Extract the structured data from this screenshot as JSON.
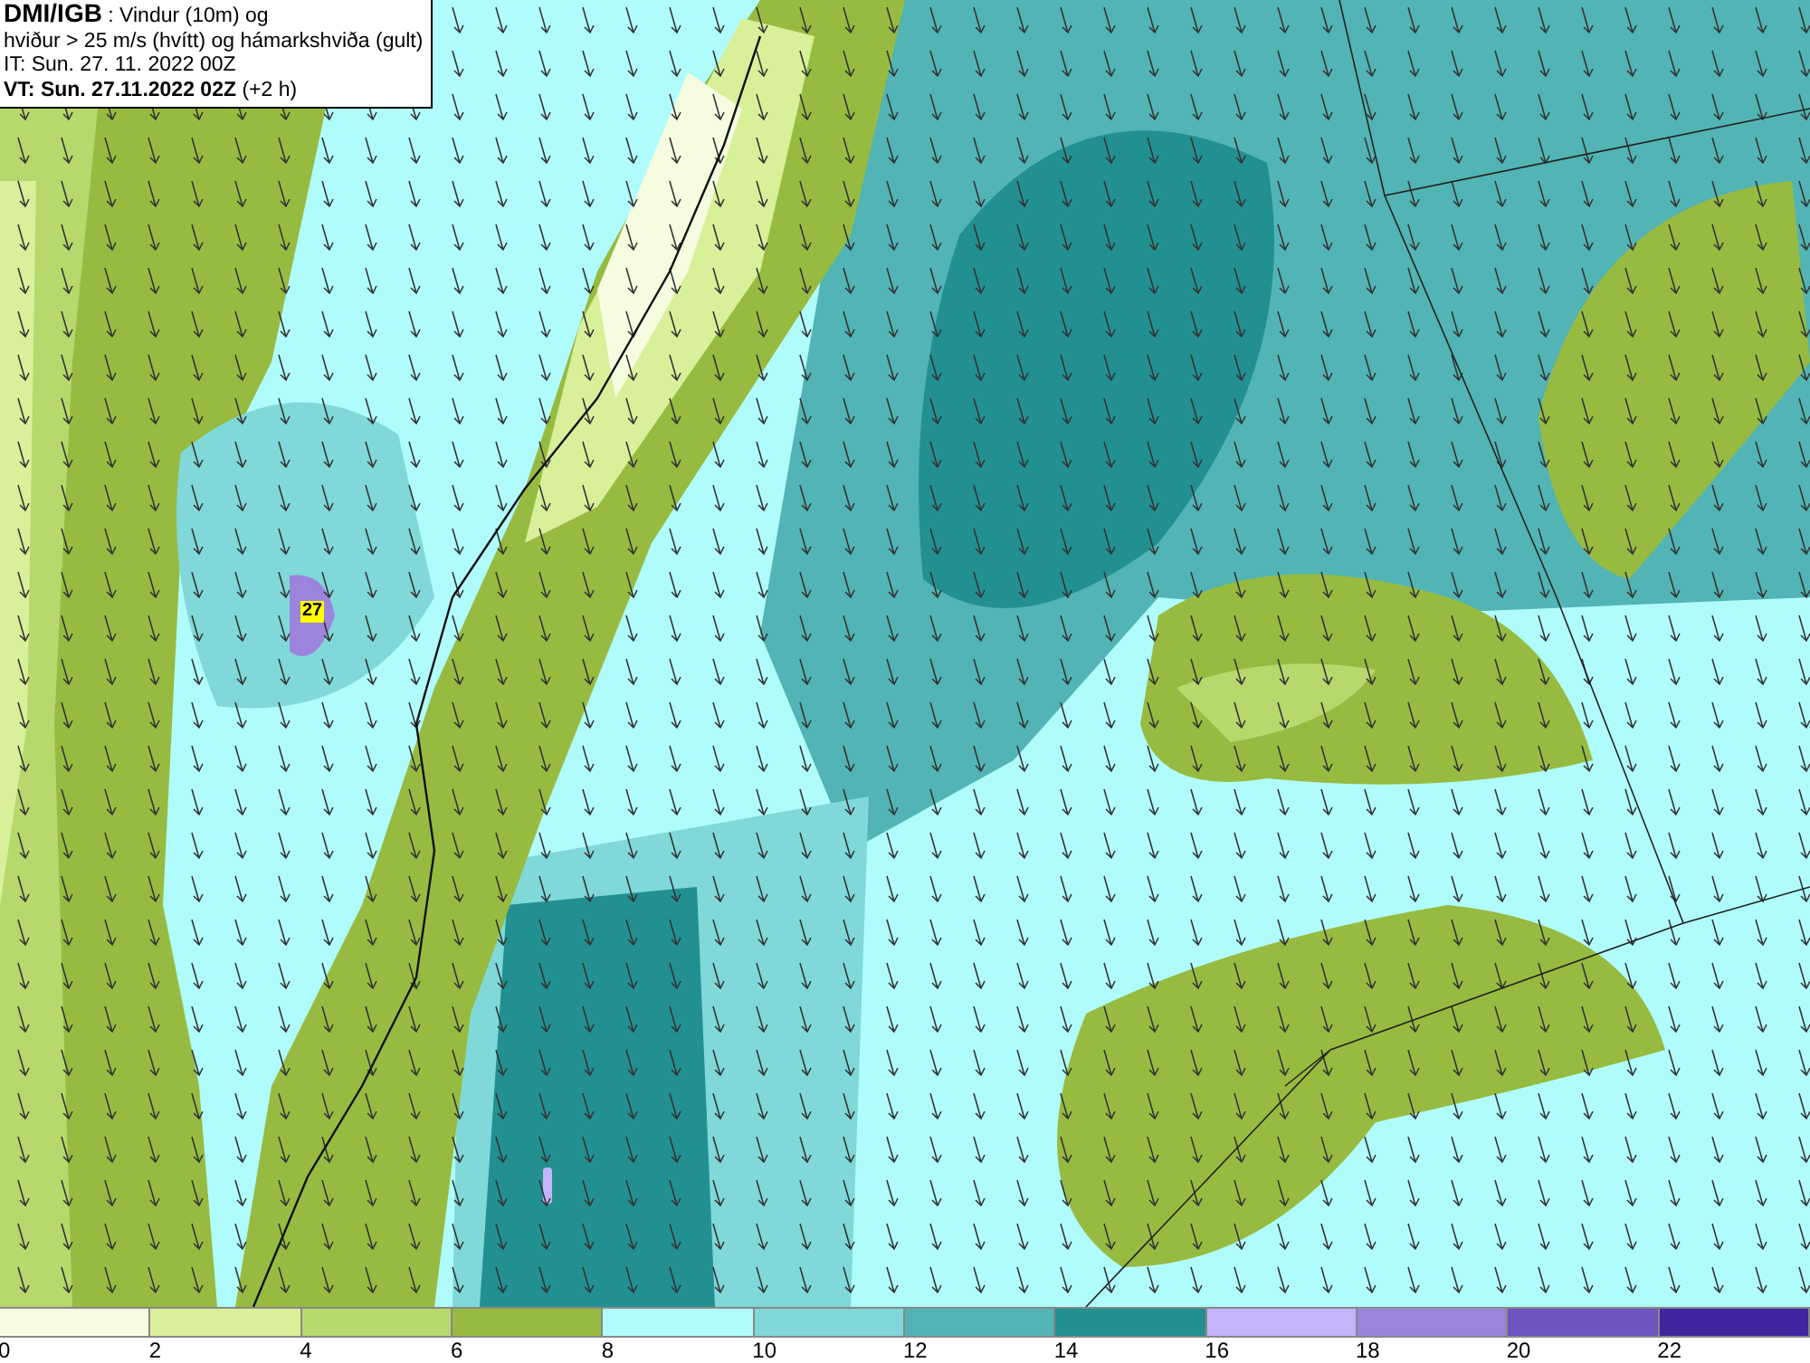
{
  "title": {
    "source": "DMI/IGB",
    "description": ": Vindur (10m) og",
    "line2": "hviður > 25 m/s (hvítt) og hámarkshviða (gult)",
    "initial_time": "IT: Sun. 27. 11. 2022 00Z",
    "valid_time": "VT: Sun. 27.11.2022 02Z",
    "offset": "(+2 h)"
  },
  "max_gust_label": "27",
  "legend": {
    "bins": [
      {
        "color": "#f5fce0"
      },
      {
        "color": "#d9f09a"
      },
      {
        "color": "#b7d86c"
      },
      {
        "color": "#97bb40"
      },
      {
        "color": "#b0fcfc"
      },
      {
        "color": "#80d8d8"
      },
      {
        "color": "#52b4b4"
      },
      {
        "color": "#229090"
      },
      {
        "color": "#c4b4fc"
      },
      {
        "color": "#9c84dc"
      },
      {
        "color": "#7054c0"
      },
      {
        "color": "#4024a0"
      }
    ],
    "ticks": [
      "0",
      "2",
      "4",
      "6",
      "8",
      "10",
      "12",
      "14",
      "16",
      "18",
      "20",
      "22"
    ]
  }
}
